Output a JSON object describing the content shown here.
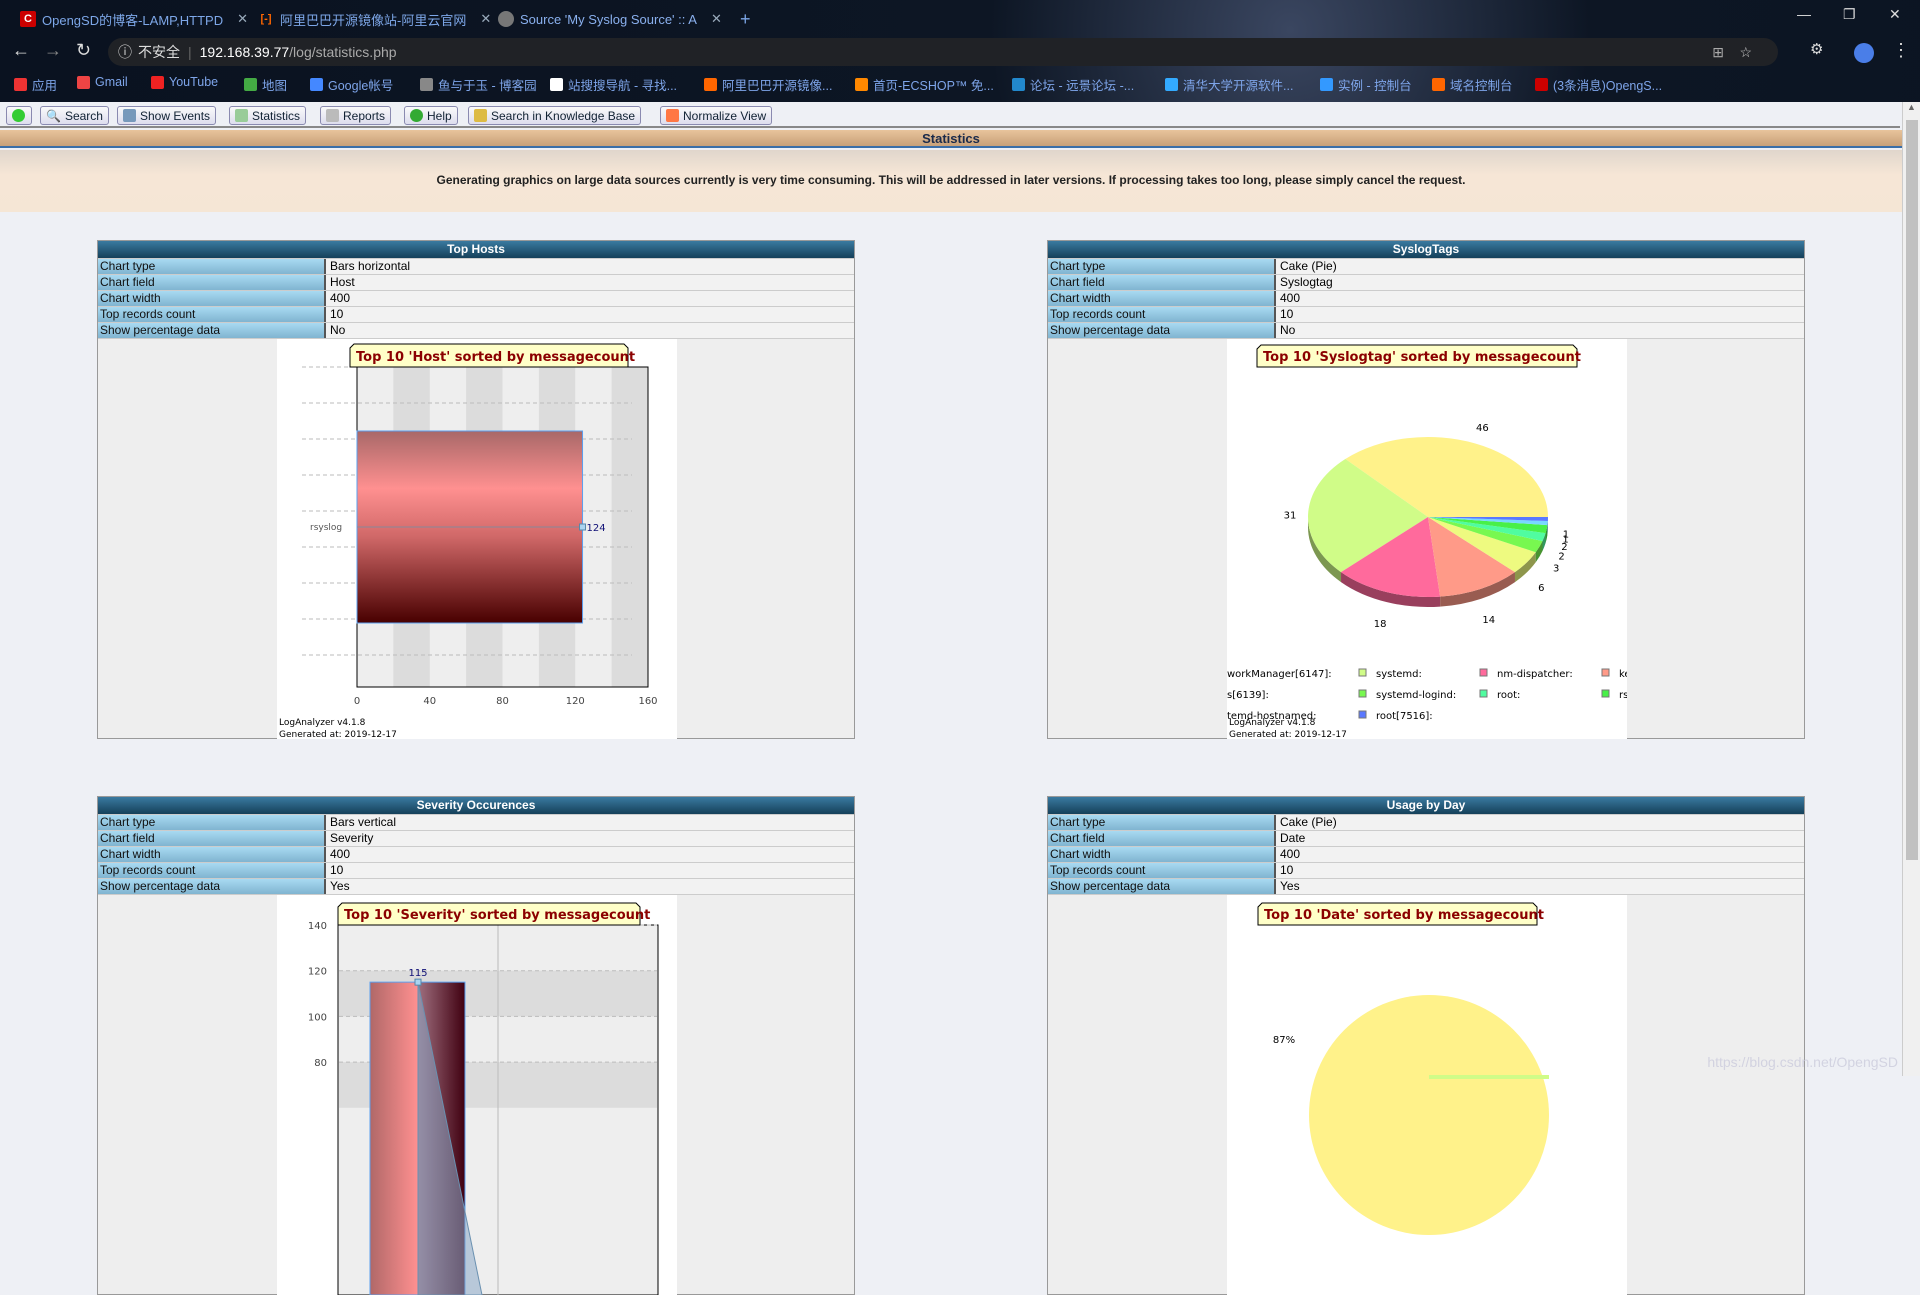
{
  "browser": {
    "tabs": [
      {
        "title": "OpengSD的博客-LAMP,HTTPD",
        "icon": "csdn-icon"
      },
      {
        "title": "阿里巴巴开源镜像站-阿里云官网",
        "icon": "aliyun-icon"
      },
      {
        "title": "Source 'My Syslog Source' :: A",
        "icon": "globe-icon"
      }
    ],
    "new_tab": "+",
    "security_label": "不安全",
    "url_host": "192.168.39.77",
    "url_path": "/log/statistics.php",
    "bookmarks": [
      "应用",
      "Gmail",
      "YouTube",
      "地图",
      "Google帐号",
      "鱼与于玉 - 博客园",
      "站搜搜导航 - 寻找...",
      "阿里巴巴开源镜像...",
      "首页-ECSHOP™ 免...",
      "论坛 - 远景论坛 -...",
      "清华大学开源软件...",
      "实例 - 控制台",
      "域名控制台",
      "(3条消息)OpengS..."
    ]
  },
  "toolbar": {
    "buttons": [
      "Search",
      "Show Events",
      "Statistics",
      "Reports",
      "Help",
      "Search in Knowledge Base",
      "Normalize View"
    ]
  },
  "section_title": "Statistics",
  "notice": "Generating graphics on large data sources currently is very time consuming. This will be addressed in later versions. If processing takes too long, please simply cancel the request.",
  "row_labels": [
    "Chart type",
    "Chart field",
    "Chart width",
    "Top records count",
    "Show percentage data"
  ],
  "panels": [
    {
      "title": "Top Hosts",
      "values": [
        "Bars horizontal",
        "Host",
        "400",
        "10",
        "No"
      ]
    },
    {
      "title": "SyslogTags",
      "values": [
        "Cake (Pie)",
        "Syslogtag",
        "400",
        "10",
        "No"
      ]
    },
    {
      "title": "Severity Occurences",
      "values": [
        "Bars vertical",
        "Severity",
        "400",
        "10",
        "Yes"
      ]
    },
    {
      "title": "Usage by Day",
      "values": [
        "Cake (Pie)",
        "Date",
        "400",
        "10",
        "Yes"
      ]
    }
  ],
  "footer": {
    "version": "LogAnalyzer v4.1.8",
    "generated": "Generated at: 2019-12-17"
  },
  "watermark": "https://blog.csdn.net/OpengSD",
  "chart_data": [
    {
      "type": "bar",
      "orientation": "horizontal",
      "title": "Top 10 'Host' sorted by messagecount",
      "categories": [
        "rsyslog"
      ],
      "values": [
        124
      ],
      "xlim": [
        0,
        160
      ],
      "xticks": [
        0,
        40,
        80,
        120,
        160
      ]
    },
    {
      "type": "pie",
      "style": "3d",
      "title": "Top 10 'Syslogtag' sorted by messagecount",
      "values": [
        46,
        31,
        18,
        14,
        6,
        3,
        2,
        2,
        1,
        1
      ],
      "colors": [
        "#fff28a",
        "#d0fc88",
        "#ff6a9c",
        "#ff9a88",
        "#eefa80",
        "#78f850",
        "#50fca0",
        "#48f048",
        "#78d8ff",
        "#5a78ff"
      ],
      "legend": [
        {
          "label": "workManager[6147]:"
        },
        {
          "label": "systemd:",
          "color": "#d0fc88"
        },
        {
          "label": "nm-dispatcher:",
          "color": "#ff6a9c"
        },
        {
          "label": "ke",
          "color": "#ff9a88"
        },
        {
          "label": "s[6139]:"
        },
        {
          "label": "systemd-logind:",
          "color": "#78f850"
        },
        {
          "label": "root:",
          "color": "#50fca0"
        },
        {
          "label": "rsy",
          "color": "#48f048"
        },
        {
          "label": "temd-hostnamed:"
        },
        {
          "label": "root[7516]:",
          "color": "#5a78ff"
        }
      ]
    },
    {
      "type": "bar",
      "orientation": "vertical",
      "title": "Top 10 'Severity' sorted by messagecount",
      "values": [
        115
      ],
      "yticks": [
        80,
        100,
        120,
        140
      ]
    },
    {
      "type": "pie",
      "style": "3d",
      "title": "Top 10 'Date' sorted by messagecount",
      "labels_visible": [
        "87%"
      ],
      "colors": [
        "#fff28a",
        "#d0fc88"
      ]
    }
  ]
}
